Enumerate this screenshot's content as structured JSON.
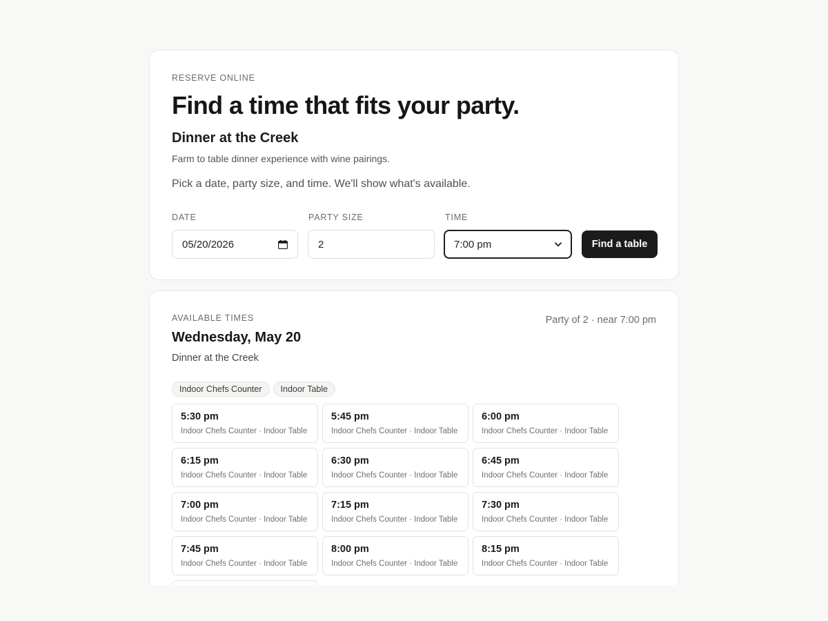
{
  "search": {
    "eyebrow": "RESERVE ONLINE",
    "title": "Find a time that fits your party.",
    "event_name": "Dinner at the Creek",
    "event_description": "Farm to table dinner experience with wine pairings.",
    "instructions": "Pick a date, party size, and time. We'll show what's available.",
    "fields": {
      "date_label": "DATE",
      "date_value": "05/20/2026",
      "party_label": "PARTY SIZE",
      "party_value": "2",
      "time_label": "TIME",
      "time_value": "7:00 pm"
    },
    "submit_label": "Find a table"
  },
  "results": {
    "eyebrow": "AVAILABLE TIMES",
    "summary": "Party of 2 · near 7:00 pm",
    "day": "Wednesday, May 20",
    "event_name": "Dinner at the Creek",
    "chips": [
      "Indoor Chefs Counter",
      "Indoor Table"
    ],
    "slots": [
      {
        "time": "5:30 pm",
        "areas": "Indoor Chefs Counter · Indoor Table"
      },
      {
        "time": "5:45 pm",
        "areas": "Indoor Chefs Counter · Indoor Table"
      },
      {
        "time": "6:00 pm",
        "areas": "Indoor Chefs Counter · Indoor Table"
      },
      {
        "time": "6:15 pm",
        "areas": "Indoor Chefs Counter · Indoor Table"
      },
      {
        "time": "6:30 pm",
        "areas": "Indoor Chefs Counter · Indoor Table"
      },
      {
        "time": "6:45 pm",
        "areas": "Indoor Chefs Counter · Indoor Table"
      },
      {
        "time": "7:00 pm",
        "areas": "Indoor Chefs Counter · Indoor Table"
      },
      {
        "time": "7:15 pm",
        "areas": "Indoor Chefs Counter · Indoor Table"
      },
      {
        "time": "7:30 pm",
        "areas": "Indoor Chefs Counter · Indoor Table"
      },
      {
        "time": "7:45 pm",
        "areas": "Indoor Chefs Counter · Indoor Table"
      },
      {
        "time": "8:00 pm",
        "areas": "Indoor Chefs Counter · Indoor Table"
      },
      {
        "time": "8:15 pm",
        "areas": "Indoor Chefs Counter · Indoor Table"
      },
      {
        "time": "",
        "areas": ""
      }
    ]
  },
  "colors": {
    "background": "#f8f8f6",
    "card": "#ffffff",
    "primary_button": "#1b1b1b",
    "muted_text": "#6b6b6b"
  }
}
